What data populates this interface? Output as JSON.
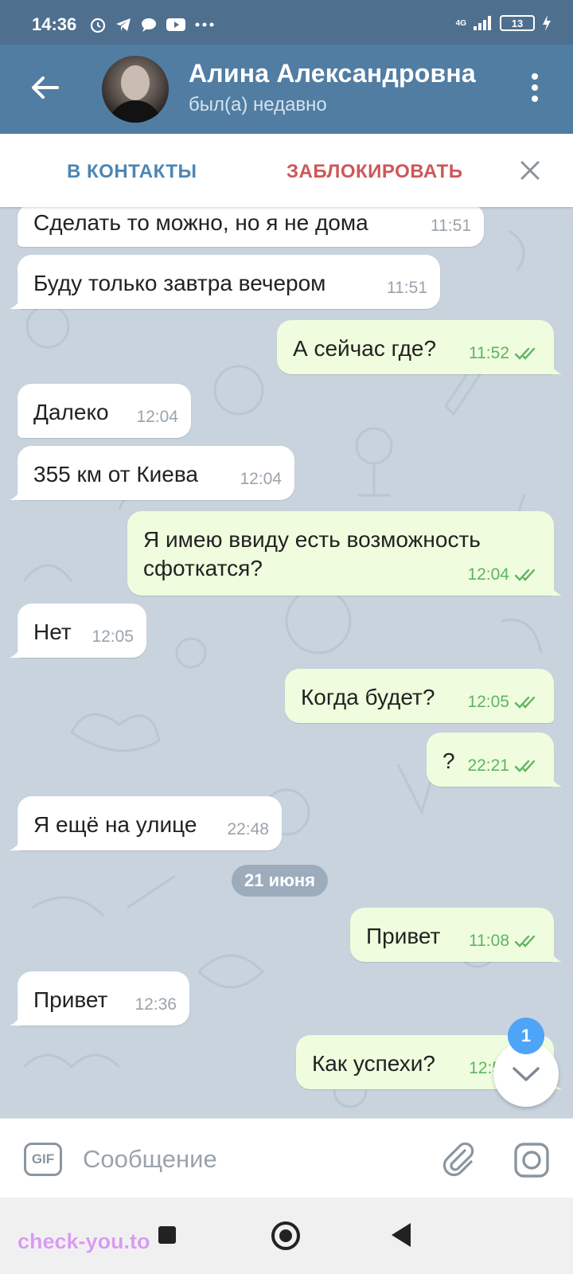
{
  "status_bar": {
    "time": "14:36",
    "network": "4G",
    "battery": "13"
  },
  "header": {
    "name": "Алина Александровна",
    "status": "был(а) недавно"
  },
  "actions": {
    "add_contact": "В КОНТАКТЫ",
    "block": "ЗАБЛОКИРОВАТЬ"
  },
  "messages": [
    {
      "dir": "in",
      "text": "Сделать то можно, но я не дома",
      "time": "11:51"
    },
    {
      "dir": "in",
      "text": "Буду только завтра вечером",
      "time": "11:51"
    },
    {
      "dir": "out",
      "text": "А сейчас где?",
      "time": "11:52"
    },
    {
      "dir": "in",
      "text": "Далеко",
      "time": "12:04"
    },
    {
      "dir": "in",
      "text": "355 км от Киева",
      "time": "12:04"
    },
    {
      "dir": "out",
      "text_line1": "Я имею ввиду есть возможность",
      "text_line2": "сфоткатся?",
      "time": "12:04"
    },
    {
      "dir": "in",
      "text": "Нет",
      "time": "12:05"
    },
    {
      "dir": "out",
      "text": "Когда будет?",
      "time": "12:05"
    },
    {
      "dir": "out",
      "text": "?",
      "time": "22:21"
    },
    {
      "dir": "in",
      "text": "Я ещё на улице",
      "time": "22:48"
    },
    {
      "dir": "out",
      "text": "Привет",
      "time": "11:08"
    },
    {
      "dir": "in",
      "text": "Привет",
      "time": "12:36"
    },
    {
      "dir": "out",
      "text": "Как успехи?",
      "time": "12:5"
    }
  ],
  "date_separator": "21 июня",
  "unread_badge": "1",
  "input": {
    "gif_label": "GIF",
    "placeholder": "Сообщение"
  },
  "watermark": "check-you.to",
  "colors": {
    "header": "#517da2",
    "outgoing_bubble": "#effdde",
    "incoming_bubble": "#ffffff",
    "block_red": "#cf5757",
    "accent_blue": "#4b86b4"
  }
}
